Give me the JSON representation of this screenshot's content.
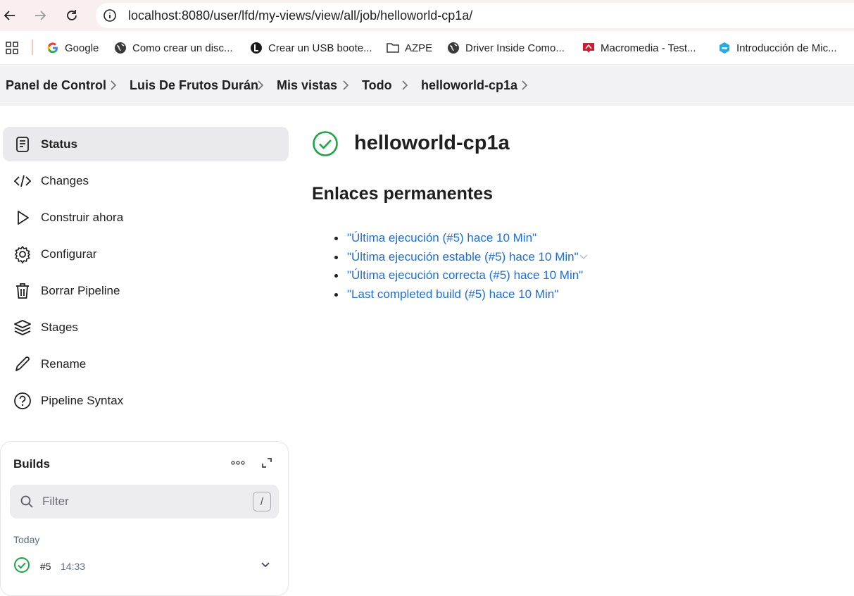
{
  "browser": {
    "url": "localhost:8080/user/lfd/my-views/view/all/job/helloworld-cp1a/",
    "bookmarks": [
      {
        "label": "Google",
        "icon": "google-icon"
      },
      {
        "label": "Como crear un disc...",
        "icon": "globe-icon"
      },
      {
        "label": "Crear un USB boote...",
        "icon": "site-icon"
      },
      {
        "label": "AZPE",
        "icon": "folder-icon"
      },
      {
        "label": "Driver Inside Como...",
        "icon": "globe-icon"
      },
      {
        "label": "Macromedia - Test...",
        "icon": "macromedia-icon"
      },
      {
        "label": "Introducción de Mic...",
        "icon": "cube-icon"
      }
    ]
  },
  "breadcrumb": [
    "Panel de Control",
    "Luis De Frutos Durán",
    "Mis vistas",
    "Todo",
    "helloworld-cp1a"
  ],
  "sidebar": {
    "items": [
      {
        "label": "Status",
        "icon": "document-icon",
        "active": true
      },
      {
        "label": "Changes",
        "icon": "code-icon"
      },
      {
        "label": "Construir ahora",
        "icon": "play-icon"
      },
      {
        "label": "Configurar",
        "icon": "gear-icon"
      },
      {
        "label": "Borrar Pipeline",
        "icon": "trash-icon"
      },
      {
        "label": "Stages",
        "icon": "layers-icon"
      },
      {
        "label": "Rename",
        "icon": "pencil-icon"
      },
      {
        "label": "Pipeline Syntax",
        "icon": "help-icon"
      }
    ]
  },
  "builds": {
    "title": "Builds",
    "filter_placeholder": "Filter",
    "filter_shortcut": "/",
    "group": "Today",
    "items": [
      {
        "number": "#5",
        "time": "14:33",
        "status": "success"
      }
    ]
  },
  "job": {
    "title": "helloworld-cp1a",
    "status": "success",
    "permalinks_title": "Enlaces permanentes",
    "permalinks": [
      "\"Última ejecución (#5) hace 10 Min\"",
      "\"Última ejecución estable (#5) hace 10 Min\"",
      "\"Última ejecución correcta (#5) hace 10 Min\"",
      "\"Last completed build (#5) hace 10 Min\""
    ]
  },
  "colors": {
    "link": "#1f6fd0",
    "success": "#1ea446",
    "crumb_bar": "#f2f2f4",
    "active_item": "#e9e9ee"
  }
}
